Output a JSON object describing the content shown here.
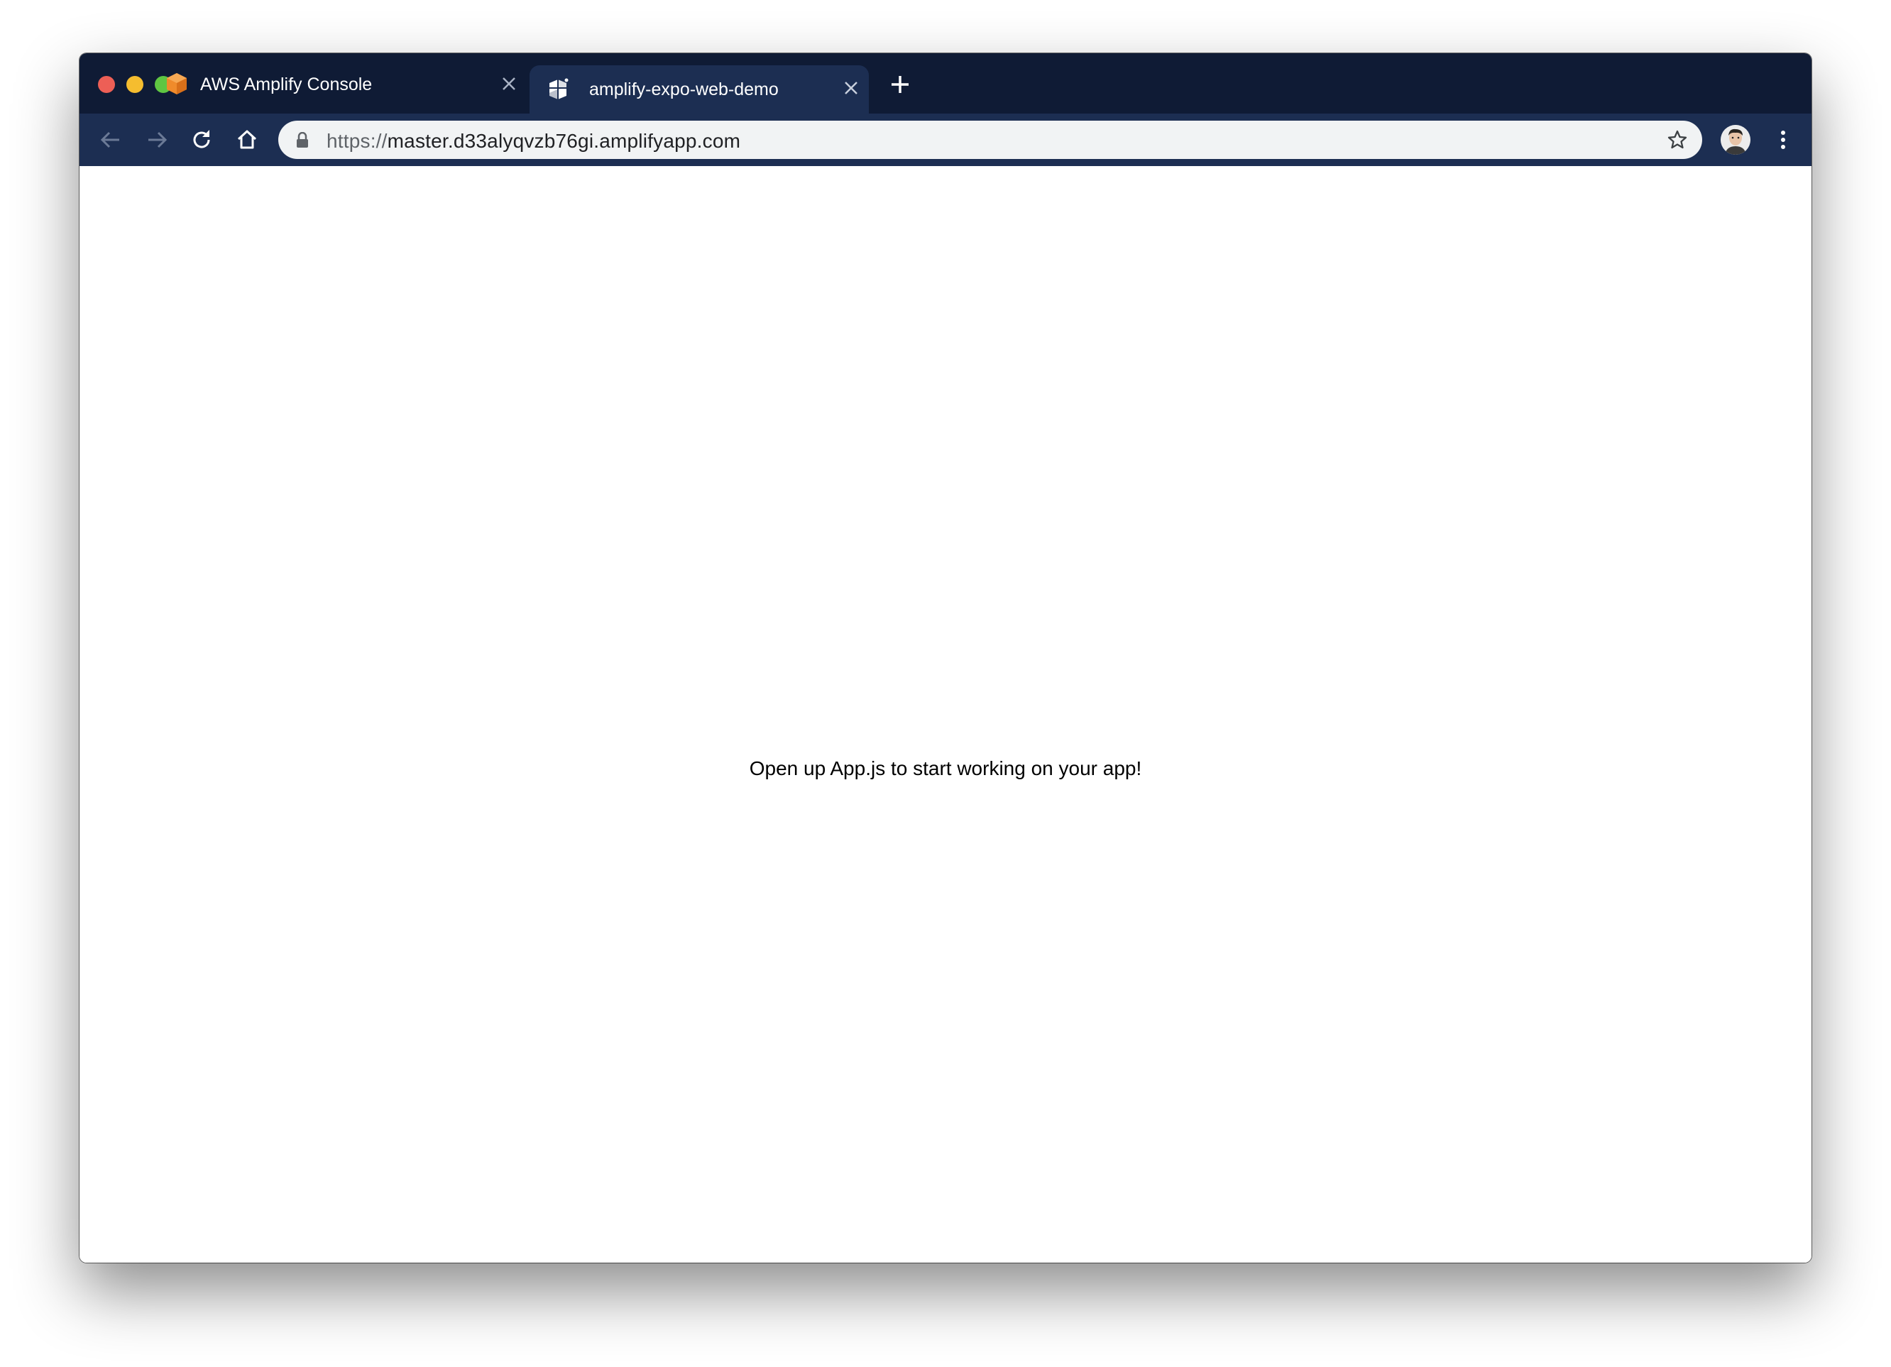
{
  "tabs": [
    {
      "title": "AWS Amplify Console",
      "icon": "aws-amplify-cube-icon",
      "active": false
    },
    {
      "title": "amplify-expo-web-demo",
      "icon": "expo-logo-icon",
      "active": true
    }
  ],
  "address_bar": {
    "scheme": "https://",
    "host": "master.d33alyqvzb76gi.amplifyapp.com"
  },
  "page": {
    "message": "Open up App.js to start working on your app!"
  },
  "colors": {
    "titlebar": "#0f1b35",
    "toolbar": "#1c2e52",
    "omnibox": "#f1f3f4",
    "close": "#ed5f56",
    "minimize": "#f5bd2f",
    "maximize": "#5fc642"
  }
}
